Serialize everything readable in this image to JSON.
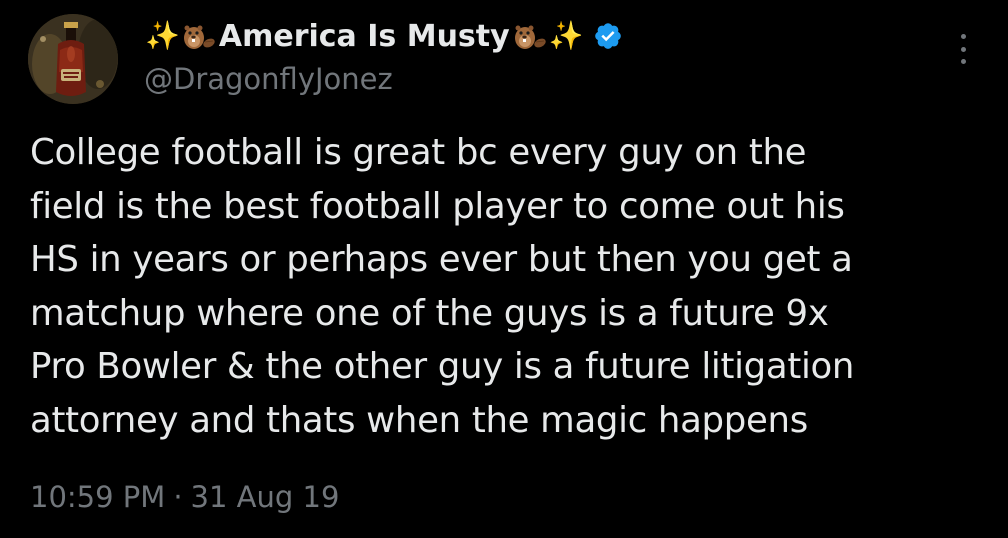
{
  "author": {
    "display_name": "America Is Musty",
    "handle": "@DragonflyJonez",
    "prefix_emoji": "✨",
    "suffix_emoji": "✨",
    "beaver_icon": "beaver-emoji",
    "verified_icon": "verified-badge-icon"
  },
  "tweet": {
    "lines": [
      "College football is great bc every guy on the",
      "field is the best football player to come out his",
      "HS in years or perhaps ever but then you get a",
      "matchup where one of the guys is a future 9x",
      "Pro Bowler & the other guy is a future litigation",
      "attorney and thats when the magic happens"
    ],
    "time": "10:59 PM",
    "separator": "·",
    "date": "31 Aug 19"
  },
  "colors": {
    "background": "#000000",
    "primary_text": "#e7e9ea",
    "secondary_text": "#71767b",
    "verified_blue": "#1d9bf0"
  },
  "icons": {
    "more": "more-options-icon"
  }
}
